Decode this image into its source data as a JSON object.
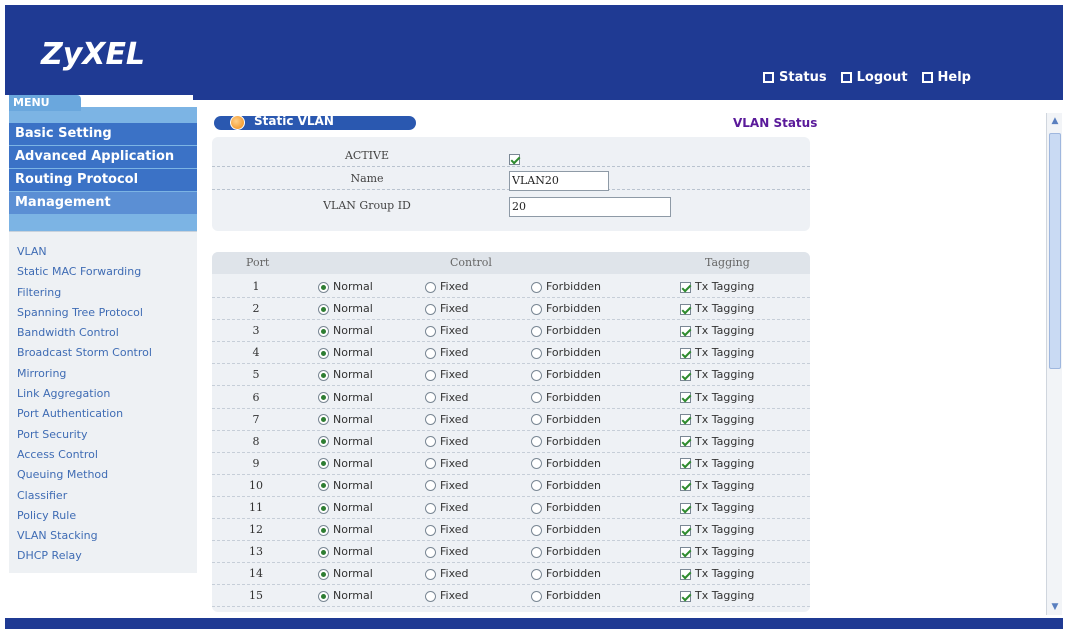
{
  "brand": {
    "logo": "ZyXEL"
  },
  "top_links": [
    {
      "label": "Status",
      "icon": "status-icon"
    },
    {
      "label": "Logout",
      "icon": "logout-icon"
    },
    {
      "label": "Help",
      "icon": "help-icon"
    }
  ],
  "sidebar": {
    "menu_tab": "MENU",
    "main_items": [
      "Basic Setting",
      "Advanced Application",
      "Routing Protocol",
      "Management"
    ],
    "sub_items": [
      "VLAN",
      "Static MAC Forwarding",
      "Filtering",
      "Spanning Tree Protocol",
      "Bandwidth Control",
      "Broadcast Storm Control",
      "Mirroring",
      "Link Aggregation",
      "Port Authentication",
      "Port Security",
      "Access Control",
      "Queuing Method",
      "Classifier",
      "Policy Rule",
      "VLAN Stacking",
      "DHCP Relay"
    ]
  },
  "page": {
    "title": "Static VLAN",
    "status_link": "VLAN Status"
  },
  "form": {
    "active_label": "ACTIVE",
    "active_checked": true,
    "name_label": "Name",
    "name_value": "VLAN20",
    "group_id_label": "VLAN Group ID",
    "group_id_value": "20"
  },
  "table": {
    "headers": {
      "port": "Port",
      "control": "Control",
      "tagging": "Tagging"
    },
    "options": {
      "normal": "Normal",
      "fixed": "Fixed",
      "forbidden": "Forbidden",
      "tagging": "Tx Tagging"
    },
    "rows": [
      {
        "port": "1",
        "control": "normal",
        "tx_tagging": true
      },
      {
        "port": "2",
        "control": "normal",
        "tx_tagging": true
      },
      {
        "port": "3",
        "control": "normal",
        "tx_tagging": true
      },
      {
        "port": "4",
        "control": "normal",
        "tx_tagging": true
      },
      {
        "port": "5",
        "control": "normal",
        "tx_tagging": true
      },
      {
        "port": "6",
        "control": "normal",
        "tx_tagging": true
      },
      {
        "port": "7",
        "control": "normal",
        "tx_tagging": true
      },
      {
        "port": "8",
        "control": "normal",
        "tx_tagging": true
      },
      {
        "port": "9",
        "control": "normal",
        "tx_tagging": true
      },
      {
        "port": "10",
        "control": "normal",
        "tx_tagging": true
      },
      {
        "port": "11",
        "control": "normal",
        "tx_tagging": true
      },
      {
        "port": "12",
        "control": "normal",
        "tx_tagging": true
      },
      {
        "port": "13",
        "control": "normal",
        "tx_tagging": true
      },
      {
        "port": "14",
        "control": "normal",
        "tx_tagging": true
      },
      {
        "port": "15",
        "control": "normal",
        "tx_tagging": true
      }
    ]
  },
  "colors": {
    "header_blue": "#1f3a93",
    "menu_blue": "#3b72c6",
    "status_link": "#5a1a9a"
  }
}
